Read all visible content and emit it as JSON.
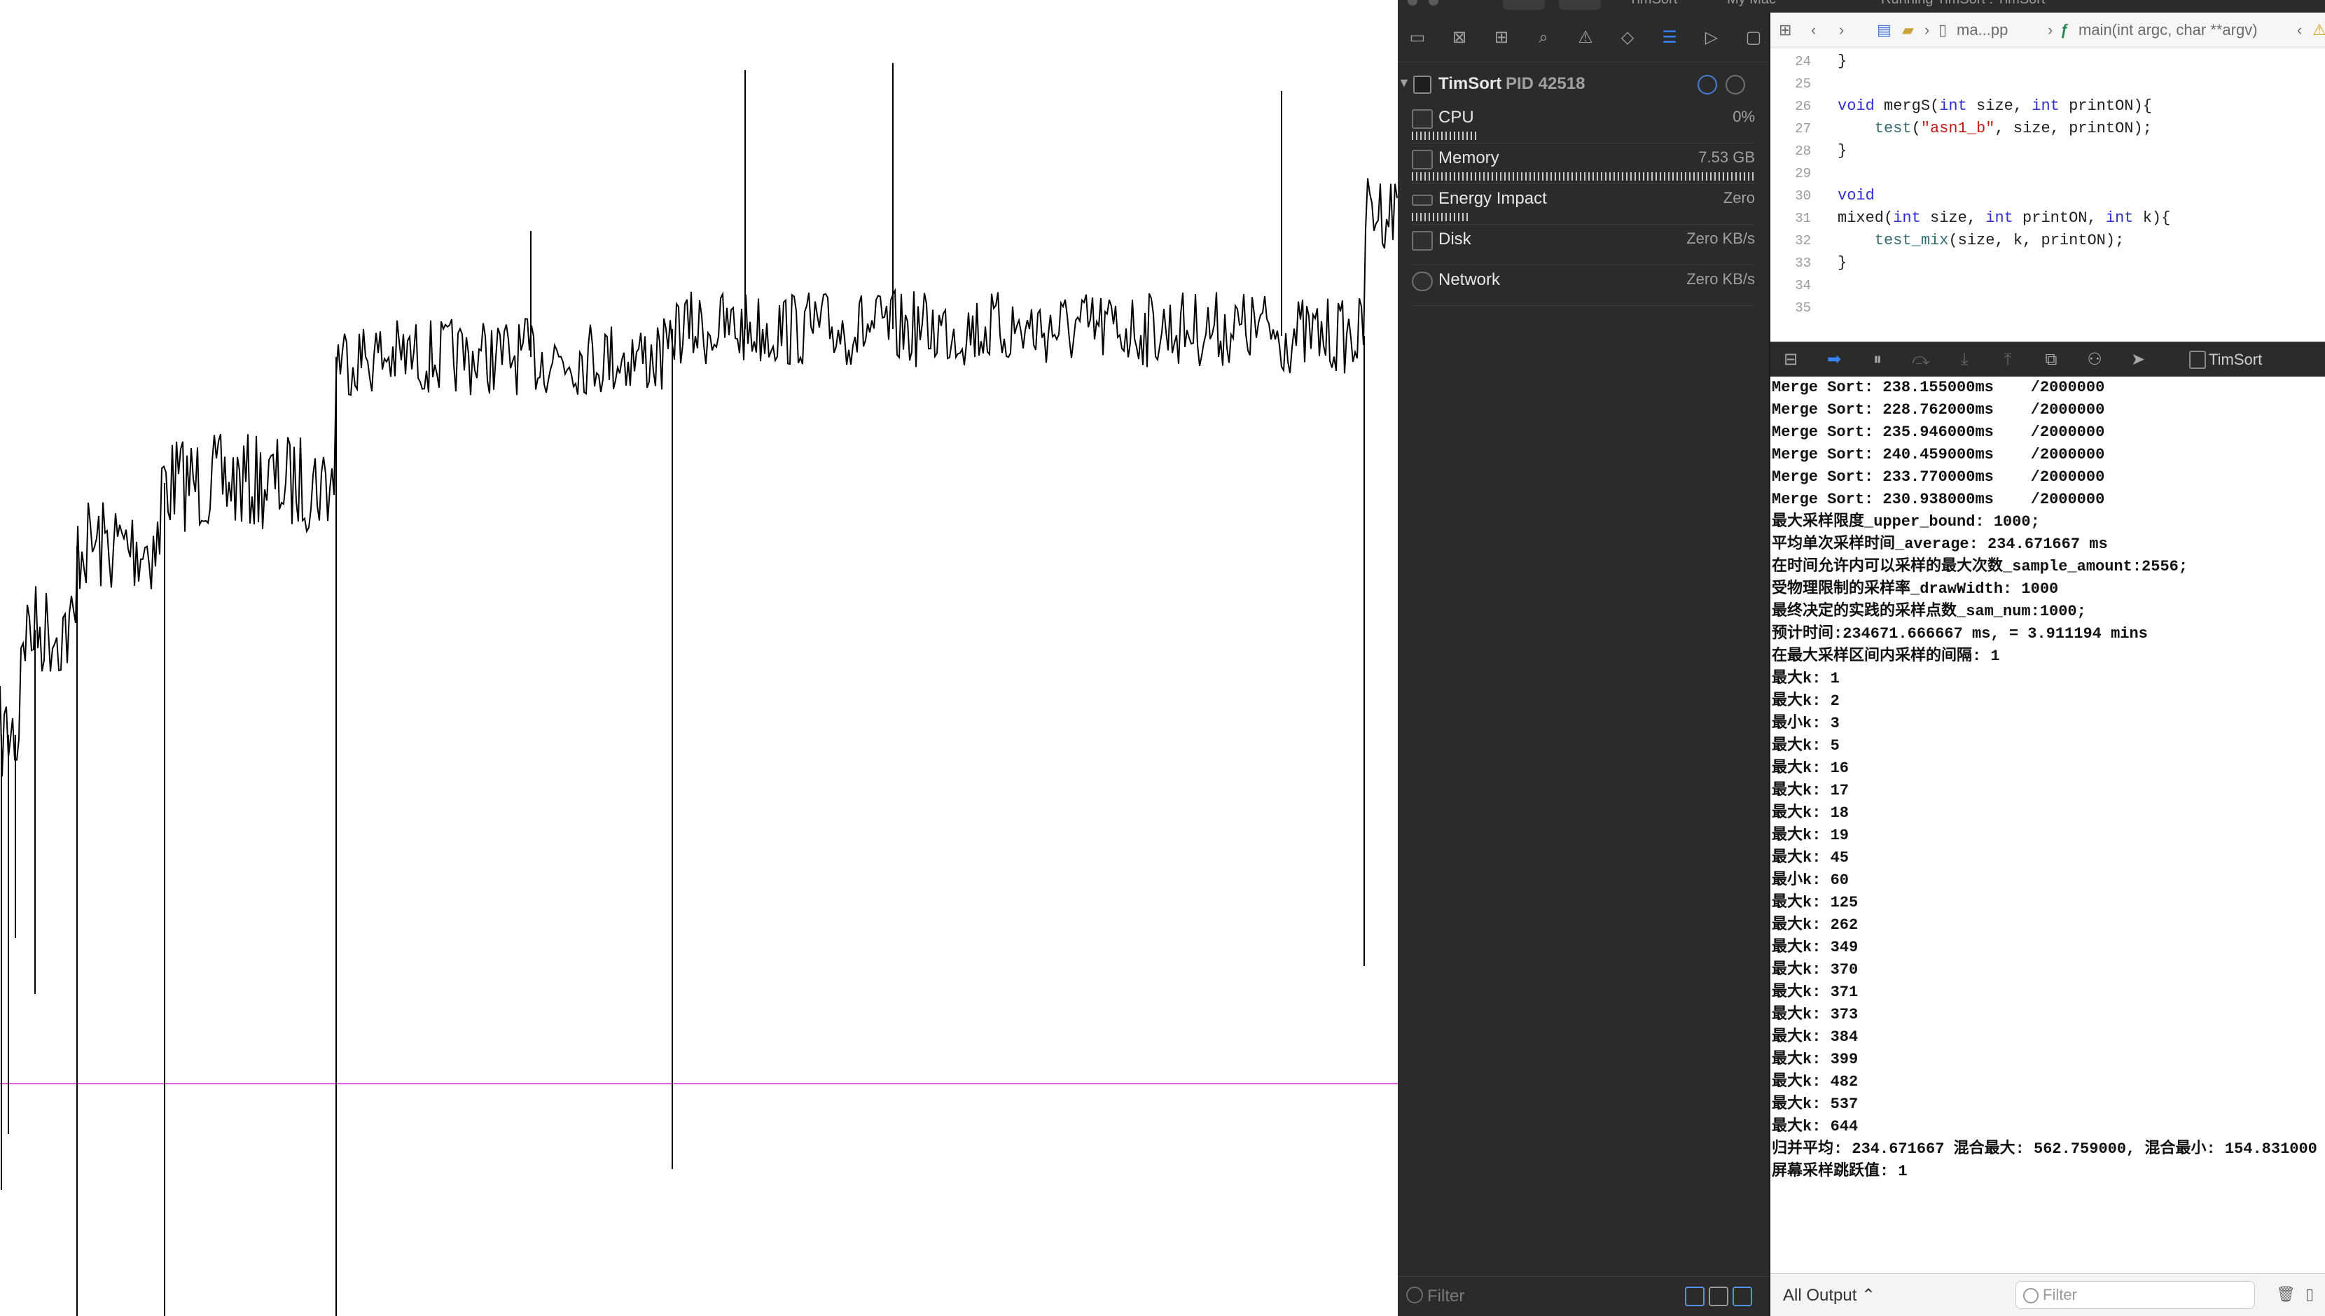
{
  "toolbar": {
    "scheme": "TimSort",
    "destination": "My Mac",
    "status": "Running TimSort : TimSort"
  },
  "navigator": {
    "process_name": "TimSort",
    "process_pid": "PID 42518",
    "gauges": [
      {
        "label": "CPU",
        "value": "0%",
        "bar": 0.19
      },
      {
        "label": "Memory",
        "value": "7.53 GB",
        "bar": 1.0
      },
      {
        "label": "Energy Impact",
        "value": "Zero",
        "bar": 0.17
      },
      {
        "label": "Disk",
        "value": "Zero KB/s",
        "bar": 0.0
      },
      {
        "label": "Network",
        "value": "Zero KB/s",
        "bar": 0.0
      }
    ],
    "filter_placeholder": "Filter"
  },
  "editor": {
    "jump_bar": {
      "file": "ma...pp",
      "function": "main(int argc, char **argv)"
    },
    "lines": [
      {
        "n": "24",
        "code": "}"
      },
      {
        "n": "25",
        "code": ""
      },
      {
        "n": "26",
        "code": "void mergS(int size, int printON){"
      },
      {
        "n": "27",
        "code": "    test(\"asn1_b\", size, printON);"
      },
      {
        "n": "28",
        "code": "}"
      },
      {
        "n": "29",
        "code": ""
      },
      {
        "n": "30",
        "code": "void"
      },
      {
        "n": "31",
        "code": "mixed(int size, int printON, int k){"
      },
      {
        "n": "32",
        "code": "    test_mix(size, k, printON);"
      },
      {
        "n": "33",
        "code": "}"
      },
      {
        "n": "34",
        "code": ""
      },
      {
        "n": "35",
        "code": ""
      }
    ]
  },
  "debug_bar": {
    "target": "TimSort"
  },
  "console": {
    "lines": [
      "Merge Sort: 238.155000ms    /2000000",
      "Merge Sort: 228.762000ms    /2000000",
      "Merge Sort: 235.946000ms    /2000000",
      "Merge Sort: 240.459000ms    /2000000",
      "Merge Sort: 233.770000ms    /2000000",
      "Merge Sort: 230.938000ms    /2000000",
      "最大采样限度_upper_bound: 1000;",
      "平均单次采样时间_average: 234.671667 ms",
      "在时间允许内可以采样的最大次数_sample_amount:2556;",
      "受物理限制的采样率_drawWidth: 1000",
      "最终决定的实践的采样点数_sam_num:1000;",
      "预计时间:234671.666667 ms, = 3.911194 mins",
      "在最大采样区间内采样的间隔: 1",
      "最大k: 1",
      "最大k: 2",
      "最小k: 3",
      "最大k: 5",
      "最大k: 16",
      "最大k: 17",
      "最大k: 18",
      "最大k: 19",
      "最大k: 45",
      "最小k: 60",
      "最大k: 125",
      "最大k: 262",
      "最大k: 349",
      "最大k: 370",
      "最大k: 371",
      "最大k: 373",
      "最大k: 384",
      "最大k: 399",
      "最大k: 482",
      "最大k: 537",
      "最大k: 644",
      "归并平均: 234.671667 混合最大: 562.759000, 混合最小: 154.831000",
      "屏幕采样跳跃值: 1"
    ],
    "output_selector": "All Output ⌃",
    "filter_placeholder": "Filter"
  },
  "colors": {
    "reference_line": "#e060e0",
    "plot_line": "#000000",
    "dark_panel": "#2b2b2b",
    "accent": "#3b82f6"
  }
}
